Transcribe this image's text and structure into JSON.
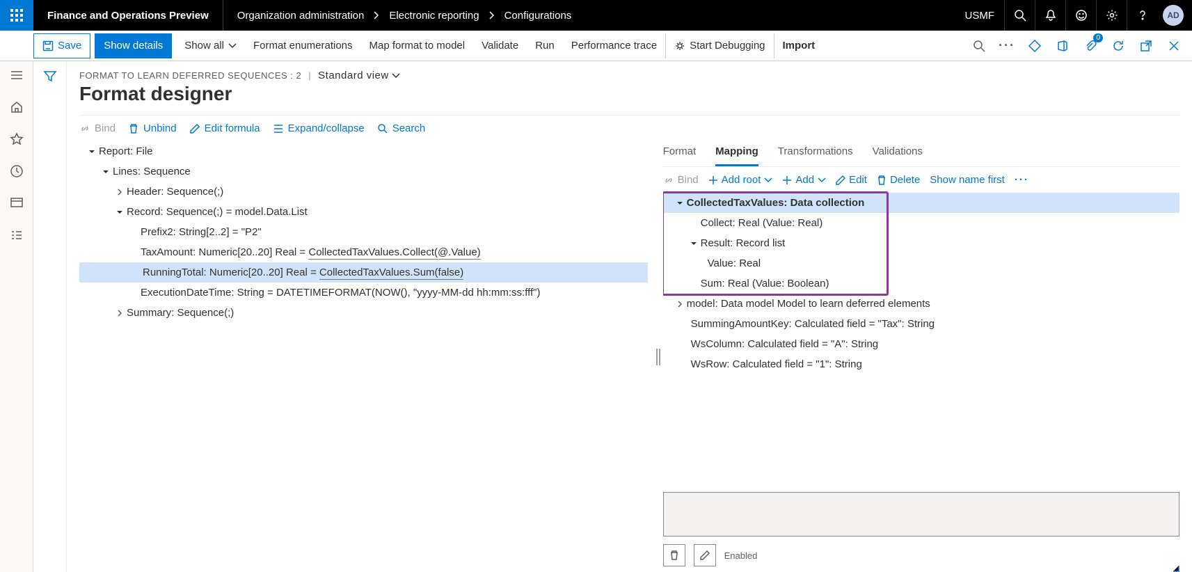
{
  "header": {
    "appTitle": "Finance and Operations Preview",
    "breadcrumb": [
      "Organization administration",
      "Electronic reporting",
      "Configurations"
    ],
    "entity": "USMF",
    "avatar": "AD"
  },
  "toolbar": {
    "save": "Save",
    "showDetails": "Show details",
    "showAll": "Show all",
    "formatEnums": "Format enumerations",
    "mapFormat": "Map format to model",
    "validate": "Validate",
    "run": "Run",
    "perfTrace": "Performance trace",
    "startDebug": "Start Debugging",
    "import": "Import",
    "badgeCount": "0"
  },
  "page": {
    "meta": "FORMAT TO LEARN DEFERRED SEQUENCES : 2",
    "stdView": "Standard view",
    "title": "Format designer"
  },
  "subToolbar": {
    "bind": "Bind",
    "unbind": "Unbind",
    "editFormula": "Edit formula",
    "expandCollapse": "Expand/collapse",
    "search": "Search"
  },
  "formatTree": {
    "n0": "Report: File",
    "n1": "Lines: Sequence",
    "n2": "Header: Sequence(;)",
    "n3": "Record: Sequence(;) = model.Data.List",
    "n4": "Prefix2: String[2..2] = \"P2\"",
    "n5a": "TaxAmount: Numeric[20..20] Real = ",
    "n5b": "CollectedTaxValues.Collect(@.Value)",
    "n6a": "RunningTotal: Numeric[20..20] Real = ",
    "n6b": "CollectedTaxValues.Sum(false)",
    "n7": "ExecutionDateTime: String = DATETIMEFORMAT(NOW(), \"yyyy-MM-dd hh:mm:ss:fff\")",
    "n8": "Summary: Sequence(;)"
  },
  "tabs": {
    "format": "Format",
    "mapping": "Mapping",
    "transformations": "Transformations",
    "validations": "Validations"
  },
  "rightToolbar": {
    "bind": "Bind",
    "addRoot": "Add root",
    "add": "Add",
    "edit": "Edit",
    "delete": "Delete",
    "showName": "Show name first"
  },
  "mappingTree": {
    "m0": "CollectedTaxValues: Data collection",
    "m1": "Collect: Real (Value: Real)",
    "m2": "Result: Record list",
    "m3": "Value: Real",
    "m4": "Sum: Real (Value: Boolean)",
    "m5": "model: Data model Model to learn deferred elements",
    "m6": "SummingAmountKey: Calculated field = \"Tax\": String",
    "m7": "WsColumn: Calculated field = \"A\": String",
    "m8": "WsRow: Calculated field = \"1\": String"
  },
  "bottom": {
    "enabled": "Enabled"
  }
}
